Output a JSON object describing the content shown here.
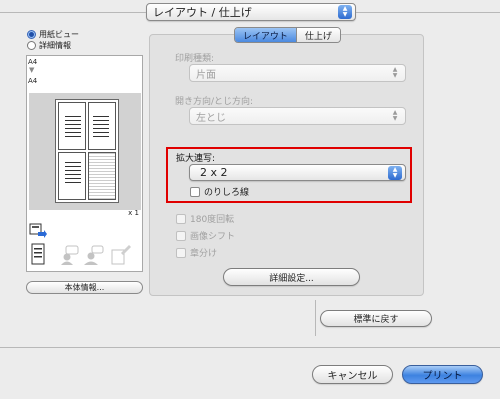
{
  "panel_select": {
    "value": "レイアウト / 仕上げ"
  },
  "left": {
    "view_options": [
      {
        "label": "用紙ビュー",
        "selected": true
      },
      {
        "label": "詳細情報",
        "selected": false
      }
    ],
    "preview": {
      "source_size": "A4",
      "output_size": "A4",
      "copies": "x 1"
    },
    "printer_info_button": "本体情報..."
  },
  "tabs": [
    {
      "label": "レイアウト",
      "active": true
    },
    {
      "label": "仕上げ",
      "active": false
    }
  ],
  "print_type": {
    "label": "印刷種類:",
    "value": "片面",
    "enabled": false
  },
  "binding": {
    "label": "開き方向/とじ方向:",
    "value": "左とじ",
    "enabled": false
  },
  "nup": {
    "label": "拡大連写:",
    "value": "2 x 2",
    "overlap_label": "のりしろ線",
    "overlap_checked": false
  },
  "options": [
    {
      "label": "180度回転",
      "enabled": false
    },
    {
      "label": "画像シフト",
      "enabled": false
    },
    {
      "label": "章分け",
      "enabled": false
    }
  ],
  "detail_button": "詳細設定...",
  "reset_button": "標準に戻す",
  "cancel_button": "キャンセル",
  "print_button": "プリント",
  "colors": {
    "accent_blue": "#4b8ae0",
    "highlight_red": "#e00000"
  }
}
